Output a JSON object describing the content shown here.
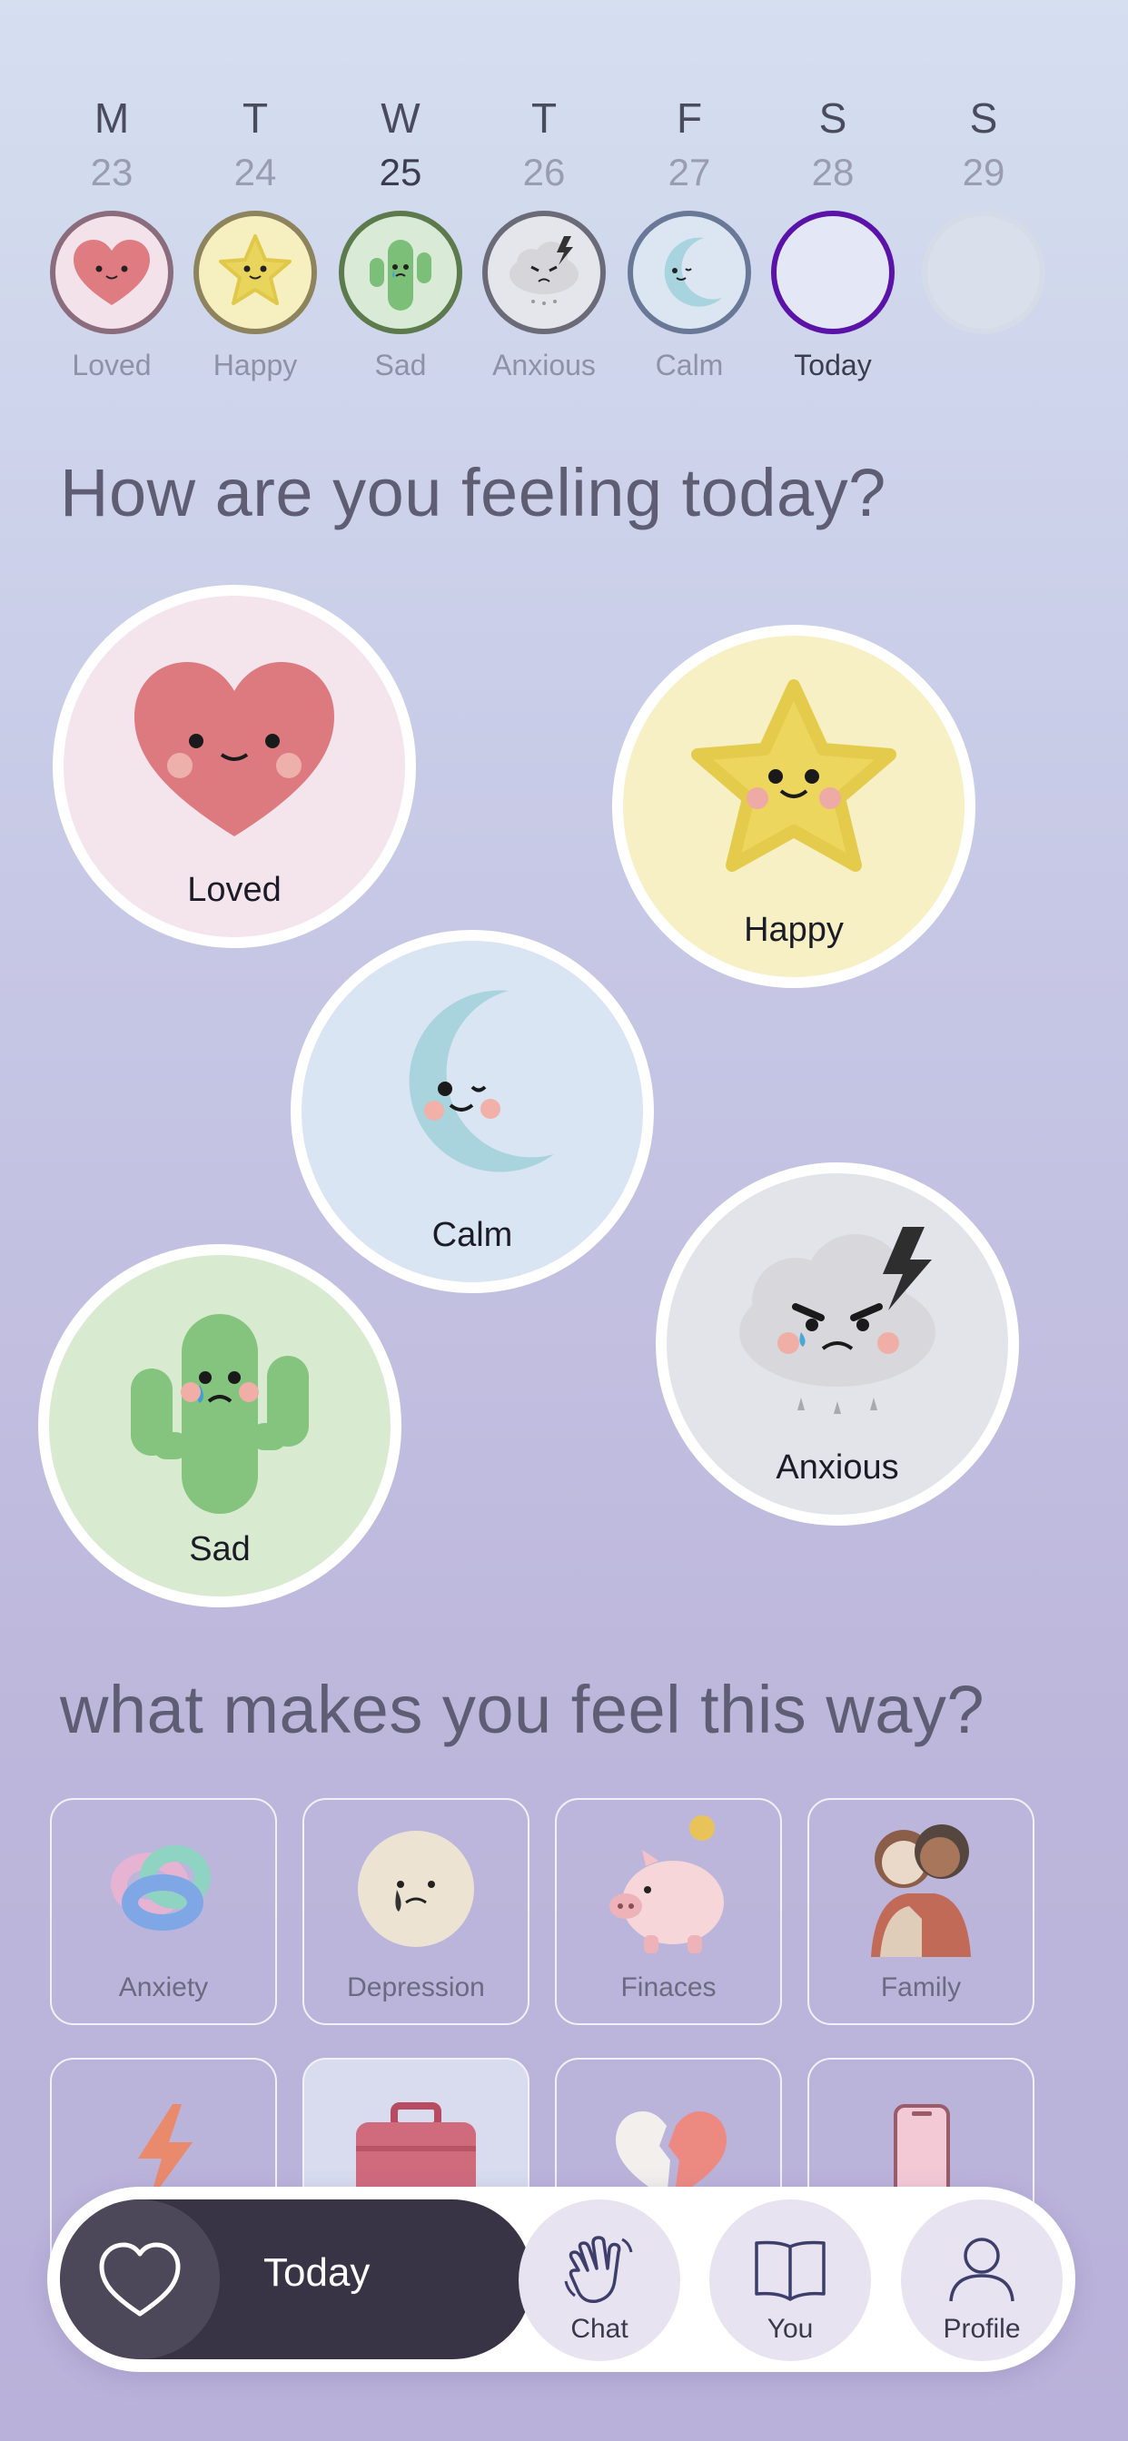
{
  "week": [
    {
      "letter": "M",
      "date": "23",
      "mood": "Loved",
      "ring_color": "#8a6c7c",
      "fill": "#f4e2ea"
    },
    {
      "letter": "T",
      "date": "24",
      "mood": "Happy",
      "ring_color": "#8d845d",
      "fill": "#f6efbf"
    },
    {
      "letter": "W",
      "date": "25",
      "mood": "Sad",
      "ring_color": "#5c7a4c",
      "fill": "#d9ead7"
    },
    {
      "letter": "T",
      "date": "26",
      "mood": "Anxious",
      "ring_color": "#6b6b78",
      "fill": "#e4e6ec"
    },
    {
      "letter": "F",
      "date": "27",
      "mood": "Calm",
      "ring_color": "#6a7898",
      "fill": "#dbe6f2"
    },
    {
      "letter": "S",
      "date": "28",
      "mood": "Today",
      "ring_color": "#5a12a8",
      "fill": "#e4e8f6"
    },
    {
      "letter": "S",
      "date": "29",
      "mood": "",
      "ring_color": "#d6dbe8",
      "fill": "#d9dfeb"
    }
  ],
  "heading_feel": "How are you feeling today?",
  "moods": [
    {
      "label": "Loved",
      "bg": "#f4e4ec"
    },
    {
      "label": "Happy",
      "bg": "#f6f0c4"
    },
    {
      "label": "Calm",
      "bg": "#d9e5f2"
    },
    {
      "label": "Anxious",
      "bg": "#e2e4ea"
    },
    {
      "label": "Sad",
      "bg": "#d8eacf"
    }
  ],
  "heading_why": "what makes you feel this way?",
  "reasons": [
    {
      "label": "Anxiety",
      "icon": "knot-icon"
    },
    {
      "label": "Depression",
      "icon": "sad-face-icon"
    },
    {
      "label": "Finaces",
      "icon": "piggy-bank-icon"
    },
    {
      "label": "Family",
      "icon": "hug-icon"
    }
  ],
  "reasons_row2_icons": [
    "lightning-icon",
    "briefcase-icon",
    "broken-heart-icon",
    "phone-icon"
  ],
  "nav": {
    "today": "Today",
    "chat": "Chat",
    "you": "You",
    "profile": "Profile"
  }
}
